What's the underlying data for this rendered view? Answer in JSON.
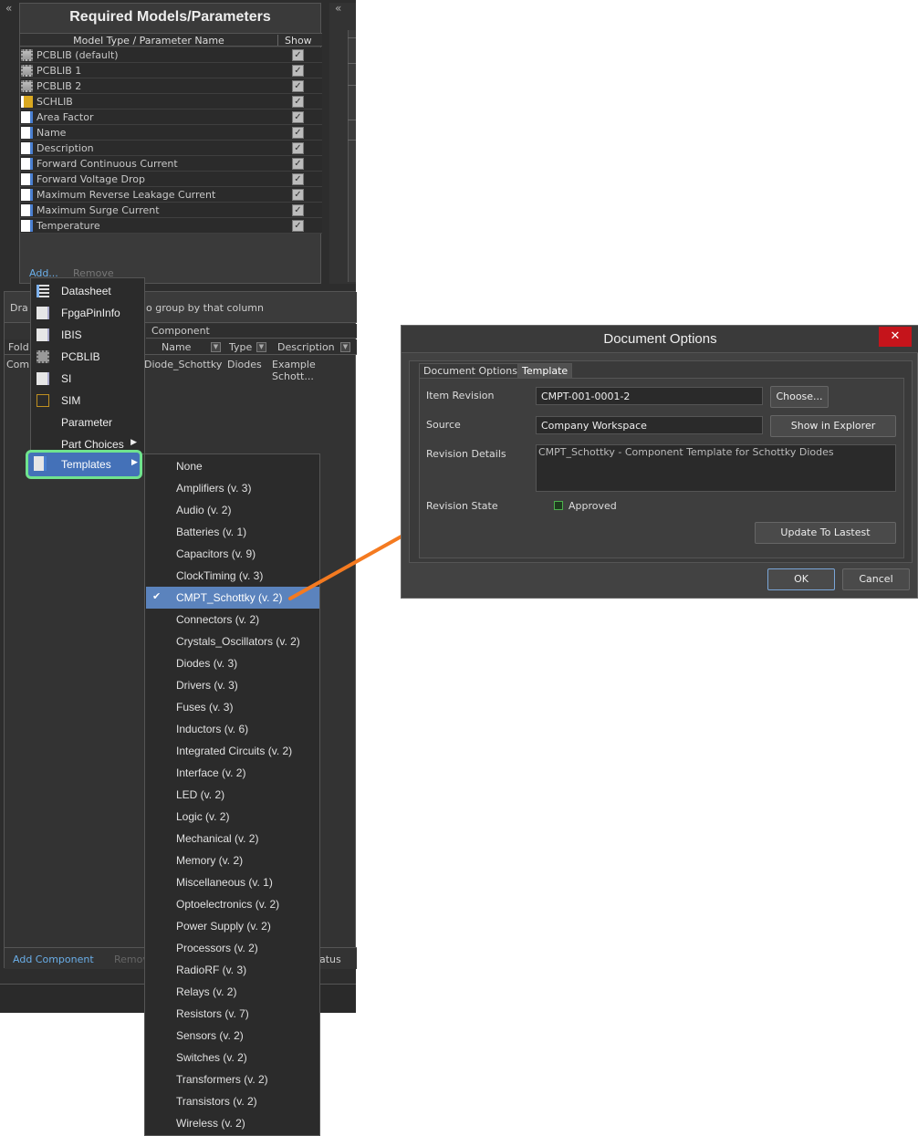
{
  "left_panel": {
    "collapse_glyph": "«",
    "title": "Required Models/Parameters",
    "columns": {
      "name": "Model Type / Parameter Name",
      "show": "Show"
    },
    "rows": [
      {
        "label": "PCBLIB (default)",
        "icon": "pcb-component-icon",
        "checked": "✓"
      },
      {
        "label": "PCBLIB 1",
        "icon": "pcb-component-icon",
        "checked": "✓"
      },
      {
        "label": "PCBLIB 2",
        "icon": "pcb-component-icon",
        "checked": "✓"
      },
      {
        "label": "SCHLIB",
        "icon": "schematic-library-icon",
        "checked": "✓"
      },
      {
        "label": "Area Factor",
        "icon": "parameter-document-icon",
        "checked": "✓"
      },
      {
        "label": "Name",
        "icon": "parameter-document-icon",
        "checked": "✓"
      },
      {
        "label": "Description",
        "icon": "parameter-document-icon",
        "checked": "✓"
      },
      {
        "label": "Forward Continuous Current",
        "icon": "parameter-document-icon",
        "checked": "✓"
      },
      {
        "label": "Forward Voltage Drop",
        "icon": "parameter-document-icon",
        "checked": "✓"
      },
      {
        "label": "Maximum Reverse Leakage Current",
        "icon": "parameter-document-icon",
        "checked": "✓"
      },
      {
        "label": "Maximum Surge Current",
        "icon": "parameter-document-icon",
        "checked": "✓"
      },
      {
        "label": "Temperature",
        "icon": "parameter-document-icon",
        "checked": "✓"
      }
    ],
    "add_label": "Add...",
    "remove_label": "Remove"
  },
  "component_panel": {
    "group_hint_prefix": "Dra",
    "group_hint": "o group by that column",
    "band_label": "Component",
    "columns": {
      "folder": "Fold",
      "name": "Name",
      "type": "Type",
      "description": "Description"
    },
    "row": {
      "folder": "Comp",
      "name": "Diode_Schottky",
      "type": "Diodes",
      "description": "Example Schott..."
    },
    "add_component": "Add Component",
    "remove": "Remov",
    "status": "atus",
    "filter_glyph": "▼"
  },
  "add_menu": {
    "items": [
      {
        "label": "Datasheet",
        "icon": "datasheet-icon"
      },
      {
        "label": "FpgaPinInfo",
        "icon": "document-icon"
      },
      {
        "label": "IBIS",
        "icon": "document-icon"
      },
      {
        "label": "PCBLIB",
        "icon": "pcb-component-icon"
      },
      {
        "label": "SI",
        "icon": "document-icon"
      },
      {
        "label": "SIM",
        "icon": "sim-model-icon"
      },
      {
        "label": "Parameter",
        "icon": ""
      },
      {
        "label": "Part Choices",
        "icon": "",
        "submenu_glyph": "▶"
      }
    ],
    "templates": {
      "label": "Templates",
      "submenu_glyph": "▶"
    }
  },
  "templates_menu": {
    "check_glyph": "✔",
    "items": [
      "None",
      "Amplifiers (v. 3)",
      "Audio (v. 2)",
      "Batteries (v. 1)",
      "Capacitors (v. 9)",
      "ClockTiming (v. 3)",
      "CMPT_Schottky (v. 2)",
      "Connectors (v. 2)",
      "Crystals_Oscillators (v. 2)",
      "Diodes (v. 3)",
      "Drivers (v. 3)",
      "Fuses (v. 3)",
      "Inductors (v. 6)",
      "Integrated Circuits (v. 2)",
      "Interface (v. 2)",
      "LED (v. 2)",
      "Logic (v. 2)",
      "Mechanical (v. 2)",
      "Memory (v. 2)",
      "Miscellaneous (v. 1)",
      "Optoelectronics (v. 2)",
      "Power Supply (v. 2)",
      "Processors (v. 2)",
      "RadioRF (v. 3)",
      "Relays (v. 2)",
      "Resistors (v. 7)",
      "Sensors (v. 2)",
      "Switches (v. 2)",
      "Transformers (v. 2)",
      "Transistors (v. 2)",
      "Wireless (v. 2)"
    ],
    "selected": "CMPT_Schottky (v. 2)"
  },
  "dialog": {
    "title": "Document Options",
    "close_glyph": "✕",
    "tabs": [
      "Document Options",
      "Template"
    ],
    "active_tab": "Template",
    "item_revision_label": "Item Revision",
    "item_revision_value": "CMPT-001-0001-2",
    "choose_button": "Choose...",
    "source_label": "Source",
    "source_value": "Company Workspace",
    "show_in_explorer_button": "Show in Explorer",
    "revision_details_label": "Revision Details",
    "revision_details_value": "CMPT_Schottky - Component Template for Schottky Diodes",
    "revision_state_label": "Revision State",
    "revision_state_value": "Approved",
    "update_button": "Update To Lastest",
    "ok_button": "OK",
    "cancel_button": "Cancel"
  },
  "colors": {
    "accent_highlight": "#6fe38e",
    "selection": "#5b83bd",
    "arrow": "#f47a20",
    "close": "#c5141b"
  }
}
